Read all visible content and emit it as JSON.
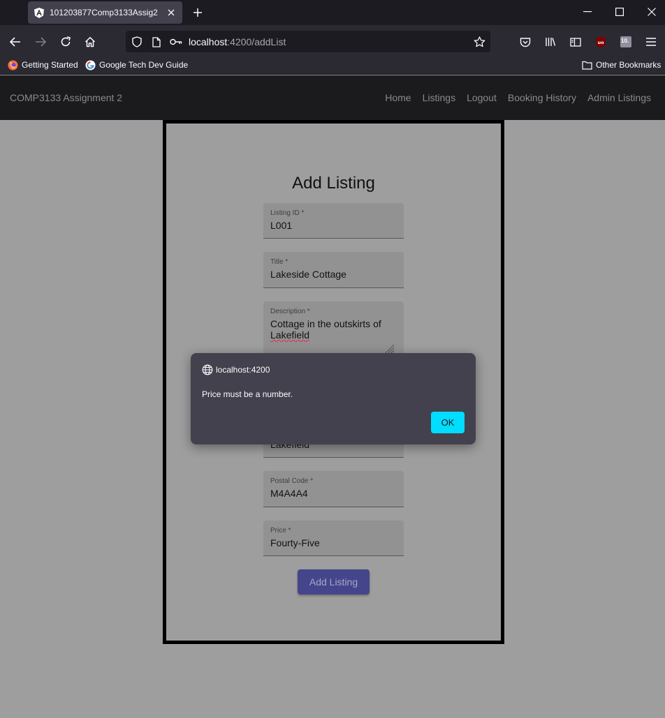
{
  "browser": {
    "tab_title": "101203877Comp3133Assig2",
    "url_host": "localhost",
    "url_rest": ":4200/addList",
    "bookmarks": [
      "Getting Started",
      "Google Tech Dev Guide"
    ],
    "other_bookmarks": "Other Bookmarks",
    "extension_badge": "10."
  },
  "app": {
    "brand": "COMP3133 Assignment 2",
    "nav": [
      "Home",
      "Listings",
      "Logout",
      "Booking History",
      "Admin Listings"
    ]
  },
  "form": {
    "title": "Add Listing",
    "fields": [
      {
        "label": "Listing ID *",
        "value": "L001"
      },
      {
        "label": "Title *",
        "value": "Lakeside Cottage"
      },
      {
        "label": "Description *",
        "value_line1": "Cottage in the outskirts of",
        "value_line2": "Lakefield"
      },
      {
        "value": "Lakefield"
      },
      {
        "label": "Postal Code *",
        "value": "M4A4A4"
      },
      {
        "label": "Price *",
        "value": "Fourty-Five"
      }
    ],
    "submit_label": "Add Listing"
  },
  "dialog": {
    "origin": "localhost:4200",
    "message": "Price must be a number.",
    "ok_label": "OK"
  },
  "colors": {
    "dialog_ok": "#00ddff",
    "submit_button": "#45458c"
  }
}
